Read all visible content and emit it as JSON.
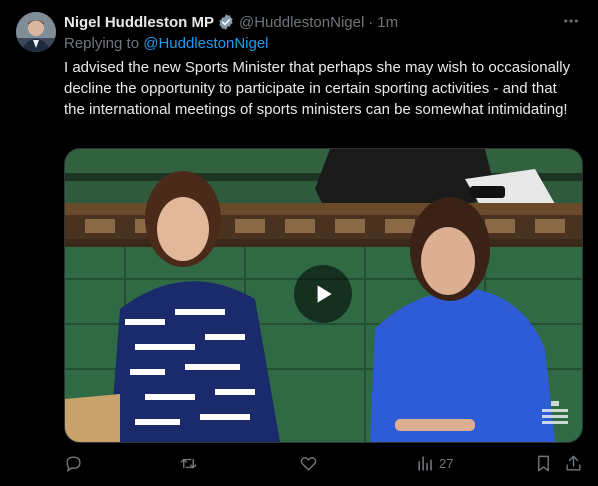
{
  "tweet": {
    "author_name": "Nigel Huddleston MP",
    "handle": "@HuddlestonNigel",
    "separator": "·",
    "time": "1m",
    "replying_prefix": "Replying to ",
    "replying_handle": "@HuddlestonNigel",
    "text": "I advised the new Sports Minister that perhaps she may wish to occasionally decline the opportunity to participate in certain sporting activities - and that the international meetings of sports ministers can be somewhat intimidating!",
    "views": "27"
  },
  "colors": {
    "background": "#000000",
    "text": "#e7e9ea",
    "muted": "#71767b",
    "link": "#1d9bf0",
    "verified_badge": "#829aab"
  },
  "icons": {
    "verified": "verified-badge-icon",
    "more": "more-dots-icon",
    "play": "play-icon",
    "reply": "reply-icon",
    "retweet": "retweet-icon",
    "like": "heart-icon",
    "views": "views-chart-icon",
    "bookmark": "bookmark-icon",
    "share": "share-icon"
  }
}
